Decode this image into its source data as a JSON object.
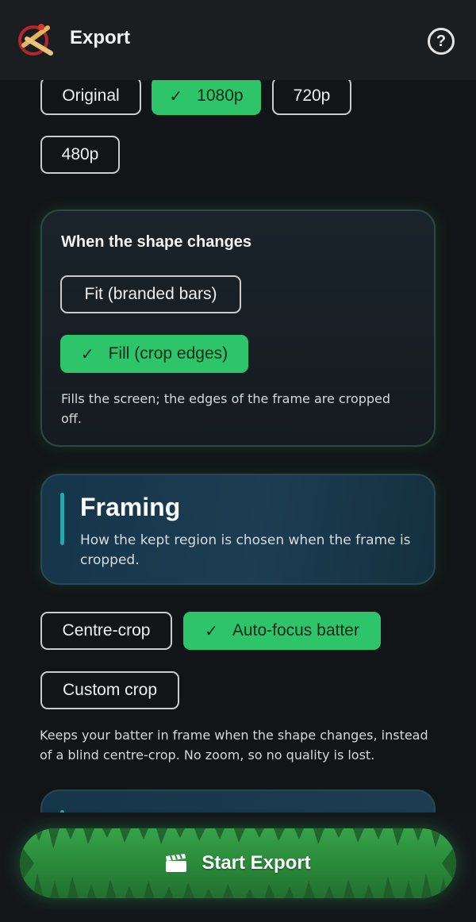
{
  "header": {
    "title": "Export",
    "help_symbol": "?",
    "logo_icon": "bat-logo-icon",
    "help_icon": "help-circle-icon"
  },
  "resolution": {
    "options": [
      {
        "label": "Original",
        "selected": false
      },
      {
        "label": "1080p",
        "selected": true
      },
      {
        "label": "720p",
        "selected": false
      },
      {
        "label": "480p",
        "selected": false
      }
    ]
  },
  "shape_change": {
    "title": "When the shape changes",
    "options": [
      {
        "label": "Fit (branded bars)",
        "selected": false
      },
      {
        "label": "Fill (crop edges)",
        "selected": true
      }
    ],
    "description": "Fills the screen; the edges of the frame are cropped off."
  },
  "framing": {
    "title": "Framing",
    "subtitle": "How the kept region is chosen when the frame is cropped.",
    "options": [
      {
        "label": "Centre-crop",
        "selected": false
      },
      {
        "label": "Auto-focus batter",
        "selected": true
      },
      {
        "label": "Custom crop",
        "selected": false
      }
    ],
    "description": "Keeps your batter in frame when the shape changes, instead of a blind centre-crop. No zoom, so no quality is lost."
  },
  "footer": {
    "export_label": "Start Export",
    "export_icon": "clapperboard-icon"
  },
  "colors": {
    "accent": "#2ec46a",
    "background": "#121517",
    "header_bg": "#1b1e20",
    "framing_accent": "#2aa6a8"
  },
  "symbols": {
    "check": "✓"
  }
}
